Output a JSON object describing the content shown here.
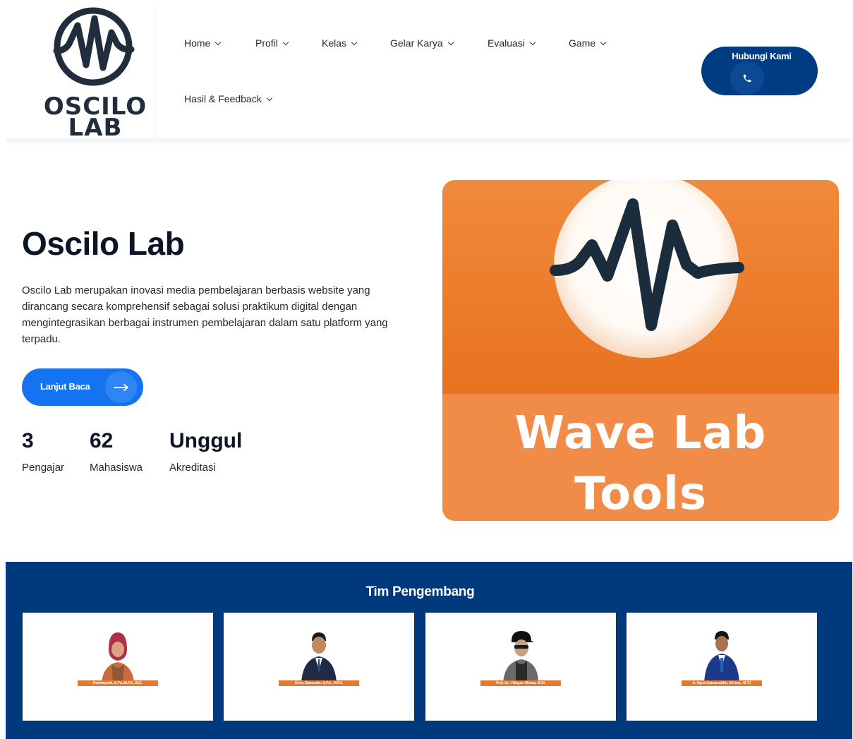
{
  "brand": {
    "logo_line1": "OSCILO",
    "logo_line2": "LAB",
    "logo_icon": "waveform-circle-icon"
  },
  "nav": {
    "items": [
      {
        "label": "Home"
      },
      {
        "label": "Profil"
      },
      {
        "label": "Kelas"
      },
      {
        "label": "Gelar Karya"
      },
      {
        "label": "Evaluasi"
      },
      {
        "label": "Game"
      },
      {
        "label": "Hasil & Feedback"
      }
    ],
    "contact": {
      "label": "Hubungi Kami",
      "icon": "phone-icon"
    }
  },
  "hero": {
    "title": "Oscilo Lab",
    "description": "Oscilo Lab merupakan inovasi media pembelajaran berbasis website yang dirancang secara komprehensif sebagai solusi praktikum digital dengan mengintegrasikan berbagai instrumen pembelajaran dalam satu platform yang terpadu.",
    "cta_label": "Lanjut Baca",
    "cta_icon": "arrow-right-icon",
    "stats": [
      {
        "value": "3",
        "label": "Pengajar"
      },
      {
        "value": "62",
        "label": "Mahasiswa"
      },
      {
        "value": "Unggul",
        "label": "Akreditasi"
      }
    ],
    "image": {
      "line1": "Wave Lab",
      "line2": "Tools",
      "colors": {
        "orange": "#ee7a2a",
        "wave": "#1b2d3c"
      }
    }
  },
  "team": {
    "title": "Tim Pengembang",
    "members": [
      {
        "name": "Darmayanti, S.Pd.,M.Pd., M.E."
      },
      {
        "name": "Dony Djamudin, S.Pd., M.Pd."
      },
      {
        "name": "Prof. Dr. I Wayan Wirata, M.Si."
      },
      {
        "name": "Ir. Agus Kamaruddin, S.Kom., M.T.I"
      }
    ]
  },
  "colors": {
    "primary_navy": "#003a7d",
    "cta_blue": "#1473f0",
    "accent_orange": "#e8772f"
  }
}
